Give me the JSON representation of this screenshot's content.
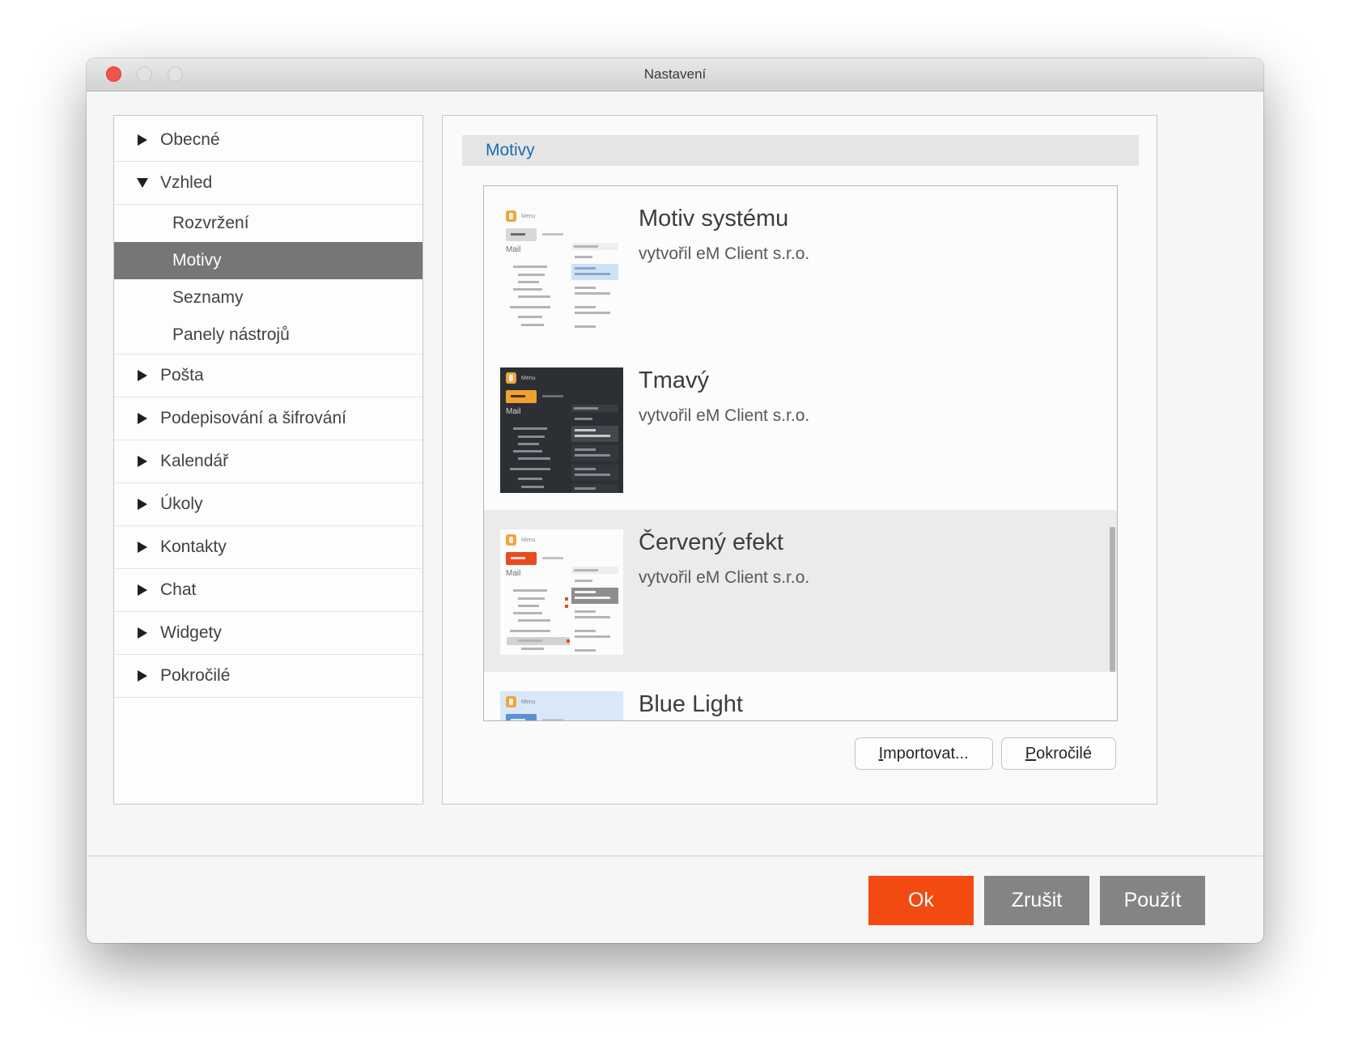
{
  "window": {
    "title": "Nastavení"
  },
  "sidebar": {
    "items": [
      {
        "label": "Obecné",
        "type": "group",
        "expanded": false,
        "selected": false
      },
      {
        "label": "Vzhled",
        "type": "group",
        "expanded": true,
        "selected": false
      },
      {
        "label": "Rozvržení",
        "type": "child",
        "selected": false
      },
      {
        "label": "Motivy",
        "type": "child",
        "selected": true
      },
      {
        "label": "Seznamy",
        "type": "child",
        "selected": false
      },
      {
        "label": "Panely nástrojů",
        "type": "child",
        "selected": false,
        "last_child": true
      },
      {
        "label": "Pošta",
        "type": "group",
        "expanded": false,
        "selected": false
      },
      {
        "label": "Podepisování a šifrování",
        "type": "group",
        "expanded": false,
        "selected": false
      },
      {
        "label": "Kalendář",
        "type": "group",
        "expanded": false,
        "selected": false
      },
      {
        "label": "Úkoly",
        "type": "group",
        "expanded": false,
        "selected": false
      },
      {
        "label": "Kontakty",
        "type": "group",
        "expanded": false,
        "selected": false
      },
      {
        "label": "Chat",
        "type": "group",
        "expanded": false,
        "selected": false
      },
      {
        "label": "Widgety",
        "type": "group",
        "expanded": false,
        "selected": false
      },
      {
        "label": "Pokročilé",
        "type": "group",
        "expanded": false,
        "selected": false
      }
    ]
  },
  "panel": {
    "header": "Motivy",
    "themes": [
      {
        "name": "Motiv systému",
        "author": "vytvořil eM Client s.r.o.",
        "variant": "light",
        "selected": false
      },
      {
        "name": "Tmavý",
        "author": "vytvořil eM Client s.r.o.",
        "variant": "dark",
        "selected": false
      },
      {
        "name": "Červený efekt",
        "author": "vytvořil eM Client s.r.o.",
        "variant": "red",
        "selected": true
      },
      {
        "name": "Blue Light",
        "author": "",
        "variant": "blue",
        "selected": false
      }
    ],
    "import_label": "Importovat...",
    "advanced_label": "Pokročilé"
  },
  "footer": {
    "ok": "Ok",
    "cancel": "Zrušit",
    "apply": "Použít"
  },
  "colors": {
    "accent_orange": "#f24a10",
    "button_gray": "#848484",
    "header_blue": "#1a6cb1",
    "sidebar_selected": "#767676",
    "theme_selected_row": "#ebebeb",
    "close_light": "#f4534d"
  },
  "thumb_labels": {
    "menu": "Menu",
    "mail": "Mail"
  },
  "thumb_variants": {
    "light": {
      "bg": "#fcfcfc",
      "chrome_text": "#8f8f8f",
      "menu_icon": "#f0a63c",
      "new_btn": "#d8d8d8",
      "new_btn_bar": "#6b6b6b",
      "bar": "#b5b5b5",
      "bar_soft": "#c4c4c4",
      "panel_bg": "#efefef",
      "highlight": "#cde2f7",
      "highlight_bar": "#8aa9c9",
      "msg_bg": "transparent",
      "mail_color": "#6e6e6e",
      "folder_highlight": "transparent",
      "accent": "#8f8f8f"
    },
    "dark": {
      "bg": "#2c2f33",
      "chrome_text": "#c9c9c9",
      "menu_icon": "#f0a63c",
      "new_btn": "#f0a132",
      "new_btn_bar": "#4a3505",
      "bar": "#878b91",
      "bar_soft": "#6a6e74",
      "panel_bg": "#3a3e43",
      "highlight": "#44484e",
      "highlight_bar": "#c9c9c9",
      "msg_bg": "#34373c",
      "mail_color": "#d6d6d6",
      "folder_highlight": "transparent",
      "accent": "#f0a132"
    },
    "red": {
      "bg": "#fcfcfc",
      "chrome_text": "#8f8f8f",
      "menu_icon": "#f0a63c",
      "new_btn": "#e94b1d",
      "new_btn_bar": "#ffd9cc",
      "bar": "#b5b5b5",
      "bar_soft": "#c4c4c4",
      "panel_bg": "#efefef",
      "highlight": "#8d8d8d",
      "highlight_bar": "#f2f2f2",
      "msg_bg": "transparent",
      "mail_color": "#6e6e6e",
      "folder_highlight": "#d2d2d2",
      "accent": "#e94b1d"
    },
    "blue": {
      "bg": "#d9e8f8",
      "chrome_text": "#73819a",
      "menu_icon": "#f0a63c",
      "new_btn": "#5d92d1",
      "new_btn_bar": "#dce9f8",
      "bar": "#a4b8d2",
      "bar_soft": "#b5c7dd",
      "panel_bg": "#cadef2",
      "highlight": "#b3cdeb",
      "highlight_bar": "#7d9cc4",
      "msg_bg": "transparent",
      "mail_color": "#5d6f88",
      "folder_highlight": "transparent",
      "accent": "#5d92d1"
    }
  }
}
